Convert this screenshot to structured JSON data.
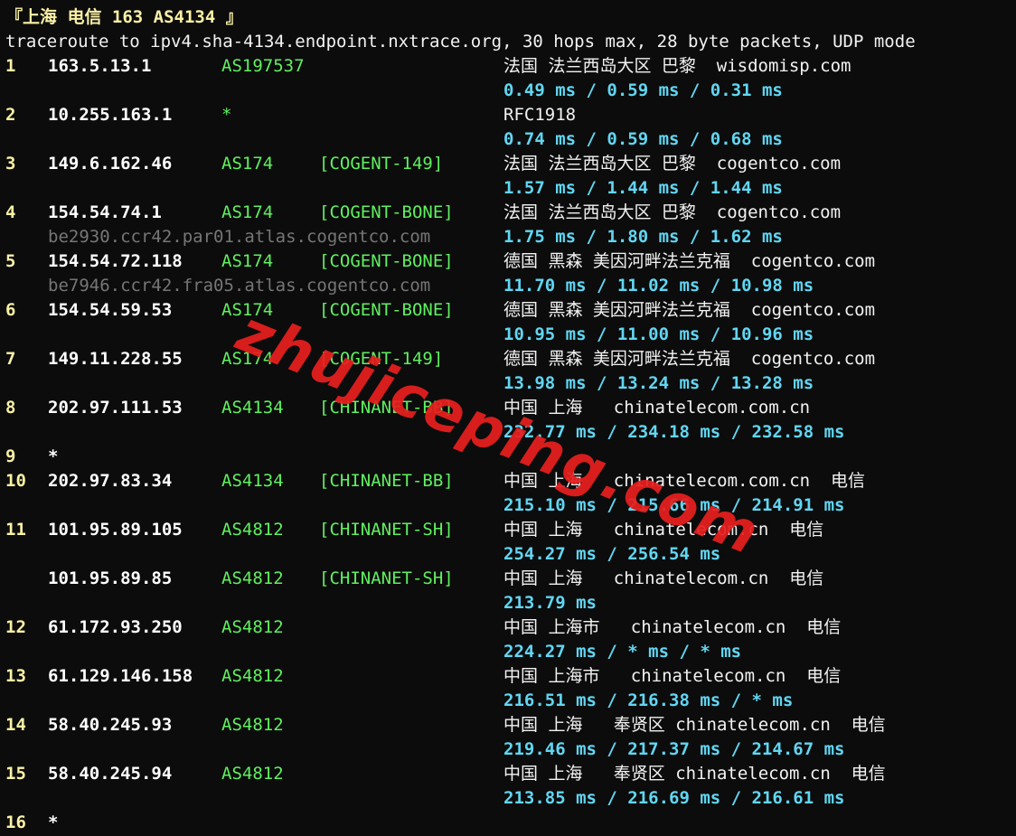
{
  "header": "『上海 电信 163 AS4134 』",
  "command": "traceroute to ipv4.sha-4134.endpoint.nxtrace.org, 30 hops max, 28 byte packets, UDP mode",
  "watermark": "zhujiceping.com",
  "colors": {
    "background": "#0c0c0c",
    "hop_number": "#f9f1a5",
    "asn": "#5ff05f",
    "rtt": "#61d6f2",
    "hostname": "#767676",
    "watermark": "#e81f1f"
  },
  "hops": [
    {
      "num": "1",
      "ip": "163.5.13.1",
      "asn": "AS197537",
      "tag": "",
      "geo": "法国 法兰西岛大区 巴黎  wisdomisp.com",
      "rtt": "0.49 ms / 0.59 ms / 0.31 ms",
      "host": ""
    },
    {
      "num": "2",
      "ip": "10.255.163.1",
      "asn": "*",
      "tag": "",
      "geo": "RFC1918",
      "rtt": "0.74 ms / 0.59 ms / 0.68 ms",
      "host": ""
    },
    {
      "num": "3",
      "ip": "149.6.162.46",
      "asn": "AS174",
      "tag": "[COGENT-149]",
      "geo": "法国 法兰西岛大区 巴黎  cogentco.com",
      "rtt": "1.57 ms / 1.44 ms / 1.44 ms",
      "host": ""
    },
    {
      "num": "4",
      "ip": "154.54.74.1",
      "asn": "AS174",
      "tag": "[COGENT-BONE]",
      "geo": "法国 法兰西岛大区 巴黎  cogentco.com",
      "rtt": "1.75 ms / 1.80 ms / 1.62 ms",
      "host": "be2930.ccr42.par01.atlas.cogentco.com"
    },
    {
      "num": "5",
      "ip": "154.54.72.118",
      "asn": "AS174",
      "tag": "[COGENT-BONE]",
      "geo": "德国 黑森 美因河畔法兰克福  cogentco.com",
      "rtt": "11.70 ms / 11.02 ms / 10.98 ms",
      "host": "be7946.ccr42.fra05.atlas.cogentco.com"
    },
    {
      "num": "6",
      "ip": "154.54.59.53",
      "asn": "AS174",
      "tag": "[COGENT-BONE]",
      "geo": "德国 黑森 美因河畔法兰克福  cogentco.com",
      "rtt": "10.95 ms / 11.00 ms / 10.96 ms",
      "host": ""
    },
    {
      "num": "7",
      "ip": "149.11.228.55",
      "asn": "AS174",
      "tag": "[COGENT-149]",
      "geo": "德国 黑森 美因河畔法兰克福  cogentco.com",
      "rtt": "13.98 ms / 13.24 ms / 13.28 ms",
      "host": ""
    },
    {
      "num": "8",
      "ip": "202.97.111.53",
      "asn": "AS4134",
      "tag": "[CHINANET-BB]",
      "geo": "中国 上海   chinatelecom.com.cn",
      "rtt": "232.77 ms / 234.18 ms / 232.58 ms",
      "host": ""
    },
    {
      "num": "9",
      "ip": "*",
      "asn": "",
      "tag": "",
      "geo": "",
      "rtt": "",
      "host": ""
    },
    {
      "num": "10",
      "ip": "202.97.83.34",
      "asn": "AS4134",
      "tag": "[CHINANET-BB]",
      "geo": "中国 上海   chinatelecom.com.cn  电信",
      "rtt": "215.10 ms / 215.66 ms / 214.91 ms",
      "host": ""
    },
    {
      "num": "11",
      "ip": "101.95.89.105",
      "asn": "AS4812",
      "tag": "[CHINANET-SH]",
      "geo": "中国 上海   chinatelecom.cn  电信",
      "rtt": "254.27 ms / 256.54 ms",
      "host": ""
    },
    {
      "num": "",
      "ip": "101.95.89.85",
      "asn": "AS4812",
      "tag": "[CHINANET-SH]",
      "geo": "中国 上海   chinatelecom.cn  电信",
      "rtt": "213.79 ms",
      "host": ""
    },
    {
      "num": "12",
      "ip": "61.172.93.250",
      "asn": "AS4812",
      "tag": "",
      "geo": "中国 上海市   chinatelecom.cn  电信",
      "rtt": "224.27 ms / * ms / * ms",
      "host": ""
    },
    {
      "num": "13",
      "ip": "61.129.146.158",
      "asn": "AS4812",
      "tag": "",
      "geo": "中国 上海市   chinatelecom.cn  电信",
      "rtt": "216.51 ms / 216.38 ms / * ms",
      "host": ""
    },
    {
      "num": "14",
      "ip": "58.40.245.93",
      "asn": "AS4812",
      "tag": "",
      "geo": "中国 上海   奉贤区 chinatelecom.cn  电信",
      "rtt": "219.46 ms / 217.37 ms / 214.67 ms",
      "host": ""
    },
    {
      "num": "15",
      "ip": "58.40.245.94",
      "asn": "AS4812",
      "tag": "",
      "geo": "中国 上海   奉贤区 chinatelecom.cn  电信",
      "rtt": "213.85 ms / 216.69 ms / 216.61 ms",
      "host": ""
    },
    {
      "num": "16",
      "ip": "*",
      "asn": "",
      "tag": "",
      "geo": "",
      "rtt": "",
      "host": ""
    }
  ]
}
